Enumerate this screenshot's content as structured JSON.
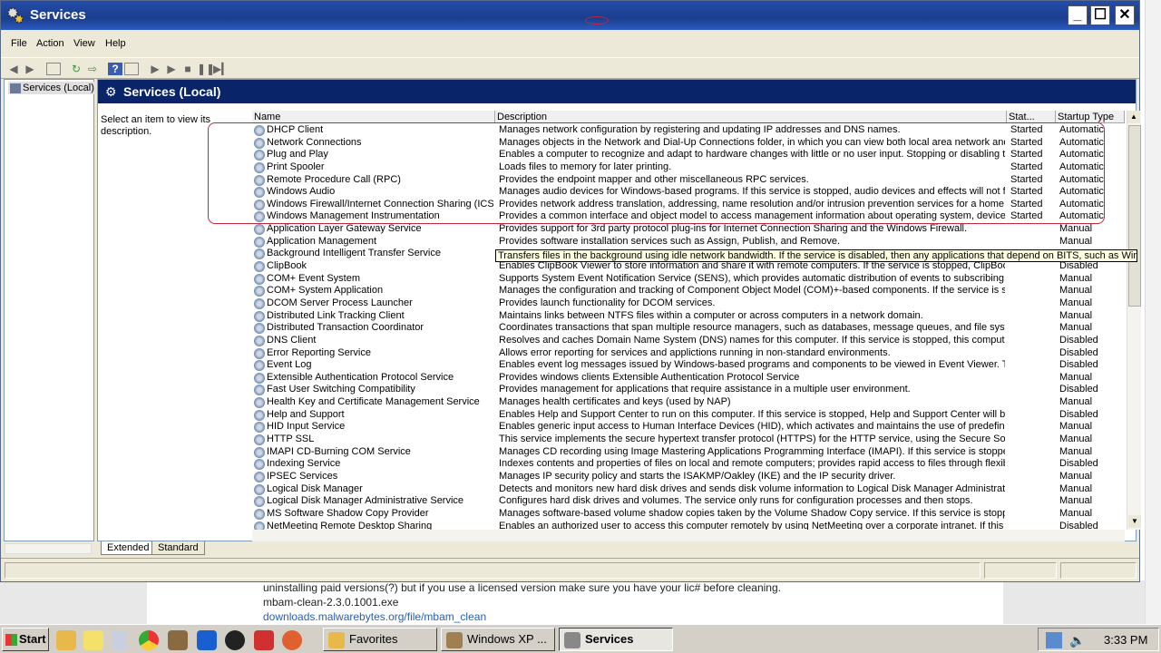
{
  "window": {
    "title": "Services"
  },
  "menu": [
    "File",
    "Action",
    "View",
    "Help"
  ],
  "tree": {
    "item": "Services (Local)"
  },
  "pane": {
    "title": "Services (Local)",
    "description_hint": "Select an item to view its description."
  },
  "columns": [
    "Name",
    "Description",
    "Stat...",
    "Startup Type"
  ],
  "services": [
    {
      "name": "DHCP Client",
      "desc": "Manages network configuration by registering and updating IP addresses and DNS names.",
      "status": "Started",
      "startup": "Automatic"
    },
    {
      "name": "Network Connections",
      "desc": "Manages objects in the Network and Dial-Up Connections folder, in which you can view both local area network and re...",
      "status": "Started",
      "startup": "Automatic"
    },
    {
      "name": "Plug and Play",
      "desc": "Enables a computer to recognize and adapt to hardware changes with little or no user input. Stopping or disabling this ...",
      "status": "Started",
      "startup": "Automatic"
    },
    {
      "name": "Print Spooler",
      "desc": "Loads files to memory for later printing.",
      "status": "Started",
      "startup": "Automatic"
    },
    {
      "name": "Remote Procedure Call (RPC)",
      "desc": "Provides the endpoint mapper and other miscellaneous RPC services.",
      "status": "Started",
      "startup": "Automatic"
    },
    {
      "name": "Windows Audio",
      "desc": "Manages audio devices for Windows-based programs. If this service is stopped, audio devices and effects will not func...",
      "status": "Started",
      "startup": "Automatic"
    },
    {
      "name": "Windows Firewall/Internet Connection Sharing (ICS)",
      "desc": "Provides network address translation, addressing, name resolution and/or intrusion prevention services for a home or ...",
      "status": "Started",
      "startup": "Automatic"
    },
    {
      "name": "Windows Management Instrumentation",
      "desc": "Provides a common interface and object model to access management information about operating system, devices, a...",
      "status": "Started",
      "startup": "Automatic"
    },
    {
      "name": "Application Layer Gateway Service",
      "desc": "Provides support for 3rd party protocol plug-ins for Internet Connection Sharing and the Windows Firewall.",
      "status": "",
      "startup": "Manual"
    },
    {
      "name": "Application Management",
      "desc": "Provides software installation services such as Assign, Publish, and Remove.",
      "status": "",
      "startup": "Manual"
    },
    {
      "name": "Background Intelligent Transfer Service",
      "desc": "",
      "status": "",
      "startup": ""
    },
    {
      "name": "ClipBook",
      "desc": "Enables ClipBook Viewer to store information and share it with remote computers. If the service is stopped, ClipBook V...",
      "status": "",
      "startup": "Disabled"
    },
    {
      "name": "COM+ Event System",
      "desc": "Supports System Event Notification Service (SENS), which provides automatic distribution of events to subscribing Com...",
      "status": "",
      "startup": "Manual"
    },
    {
      "name": "COM+ System Application",
      "desc": "Manages the configuration and tracking of Component Object Model (COM)+-based components. If the service is stopp...",
      "status": "",
      "startup": "Manual"
    },
    {
      "name": "DCOM Server Process Launcher",
      "desc": "Provides launch functionality for DCOM services.",
      "status": "",
      "startup": "Manual"
    },
    {
      "name": "Distributed Link Tracking Client",
      "desc": "Maintains links between NTFS files within a computer or across computers in a network domain.",
      "status": "",
      "startup": "Manual"
    },
    {
      "name": "Distributed Transaction Coordinator",
      "desc": "Coordinates transactions that span multiple resource managers, such as databases, message queues, and file systems...",
      "status": "",
      "startup": "Manual"
    },
    {
      "name": "DNS Client",
      "desc": "Resolves and caches Domain Name System (DNS) names for this computer. If this service is stopped, this computer wi...",
      "status": "",
      "startup": "Disabled"
    },
    {
      "name": "Error Reporting Service",
      "desc": "Allows error reporting for services and applictions running in non-standard environments.",
      "status": "",
      "startup": "Disabled"
    },
    {
      "name": "Event Log",
      "desc": "Enables event log messages issued by Windows-based programs and components to be viewed in Event Viewer. This ...",
      "status": "",
      "startup": "Disabled"
    },
    {
      "name": "Extensible Authentication Protocol Service",
      "desc": "Provides windows clients Extensible Authentication Protocol Service",
      "status": "",
      "startup": "Manual"
    },
    {
      "name": "Fast User Switching Compatibility",
      "desc": "Provides management for applications that require assistance in a multiple user environment.",
      "status": "",
      "startup": "Disabled"
    },
    {
      "name": "Health Key and Certificate Management Service",
      "desc": "Manages health certificates and keys (used by NAP)",
      "status": "",
      "startup": "Manual"
    },
    {
      "name": "Help and Support",
      "desc": "Enables Help and Support Center to run on this computer. If this service is stopped, Help and Support Center will be u...",
      "status": "",
      "startup": "Disabled"
    },
    {
      "name": "HID Input Service",
      "desc": "Enables generic input access to Human Interface Devices (HID), which activates and maintains the use of predefined h...",
      "status": "",
      "startup": "Manual"
    },
    {
      "name": "HTTP SSL",
      "desc": "This service implements the secure hypertext transfer protocol (HTTPS) for the HTTP service,  using the Secure Socke...",
      "status": "",
      "startup": "Manual"
    },
    {
      "name": "IMAPI CD-Burning COM Service",
      "desc": "Manages CD recording using Image Mastering Applications Programming Interface (IMAPI). If this service is stopped, t...",
      "status": "",
      "startup": "Manual"
    },
    {
      "name": "Indexing Service",
      "desc": "Indexes contents and properties of files on local and remote computers; provides rapid access to files through flexible ...",
      "status": "",
      "startup": "Disabled"
    },
    {
      "name": "IPSEC Services",
      "desc": "Manages IP security policy and starts the ISAKMP/Oakley (IKE) and the IP security driver.",
      "status": "",
      "startup": "Manual"
    },
    {
      "name": "Logical Disk Manager",
      "desc": "Detects and monitors new hard disk drives and sends disk volume information to Logical Disk Manager Administrative ...",
      "status": "",
      "startup": "Manual"
    },
    {
      "name": "Logical Disk Manager Administrative Service",
      "desc": "Configures hard disk drives and volumes. The service only runs for configuration processes and then stops.",
      "status": "",
      "startup": "Manual"
    },
    {
      "name": "MS Software Shadow Copy Provider",
      "desc": "Manages software-based volume shadow copies taken by the Volume Shadow Copy service. If this service is stopped, ...",
      "status": "",
      "startup": "Manual"
    },
    {
      "name": "NetMeeting Remote Desktop Sharing",
      "desc": "Enables an authorized user to access this computer remotely by using NetMeeting over a corporate intranet. If this ser...",
      "status": "",
      "startup": "Disabled"
    }
  ],
  "tooltip": "Transfers files in the background using idle network bandwidth. If the service is disabled, then any applications that depend on BITS, such as Windows Update o",
  "tabs": [
    "Extended",
    "Standard"
  ],
  "background_page": {
    "line1": "uninstalling paid versions(?) but if you use a licensed version make sure you have your lic# before cleaning.",
    "line2": "mbam-clean-2.3.0.1001.exe",
    "line3": "downloads.malwarebytes.org/file/mbam_clean"
  },
  "taskbar": {
    "start": "Start",
    "tasks": [
      "Favorites",
      "Windows XP ...",
      "Services"
    ],
    "clock": "3:33 PM"
  },
  "colors": {
    "title_bar": "#1a3d8f",
    "pane_header": "#0a246a",
    "highlight_box": "#c0283c",
    "link": "#2a5db0"
  }
}
